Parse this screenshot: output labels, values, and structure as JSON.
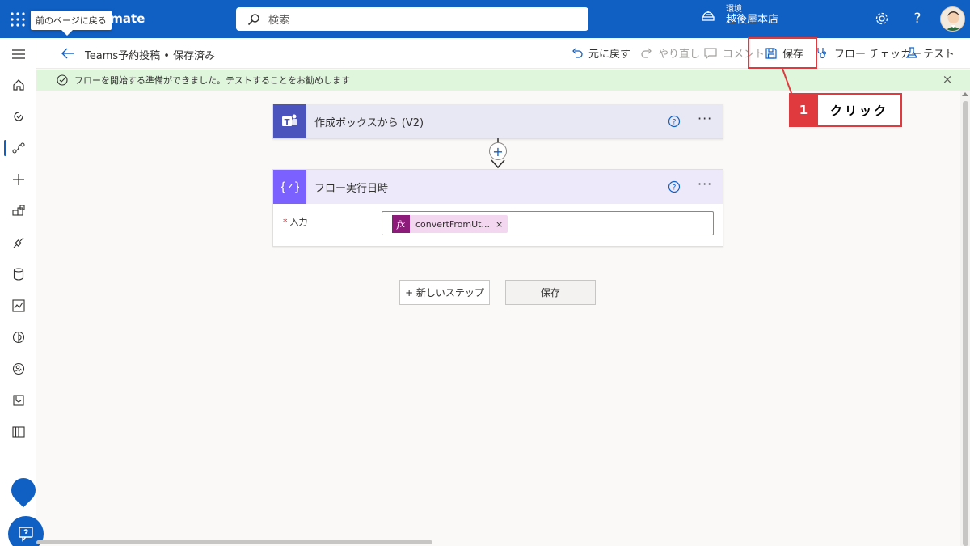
{
  "topbar": {
    "app_name": "omate",
    "tooltip": "前のページに戻る",
    "search_placeholder": "検索",
    "env_label": "環境",
    "env_value": "越後屋本店",
    "help_glyph": "?"
  },
  "cmdbar": {
    "flow_title": "Teams予約投稿 • 保存済み",
    "undo": "元に戻す",
    "redo": "やり直し",
    "comment": "コメント",
    "save": "保存",
    "flow_checker": "フロー チェッカー",
    "test": "テスト"
  },
  "message": {
    "text": "フローを開始する準備ができました。テストすることをお勧めします",
    "close_glyph": "×"
  },
  "callout": {
    "number": "1",
    "text": "クリック"
  },
  "steps": [
    {
      "title": "作成ボックスから (V2)",
      "more": "···"
    },
    {
      "title": "フロー実行日時",
      "more": "···",
      "input_label": "入力",
      "required_mark": "*",
      "token_icon": "fx",
      "token_text": "convertFromUt...",
      "token_close": "×"
    }
  ],
  "add_step_glyph": "+",
  "buttons": {
    "new_step": "+ 新しいステップ",
    "save": "保存"
  },
  "colors": {
    "brand": "#1060c4",
    "teams": "#4b53bc",
    "variable": "#7b61ff",
    "token": "#8c1b79",
    "callout": "#e03a3e",
    "success": "#dff6dd"
  }
}
